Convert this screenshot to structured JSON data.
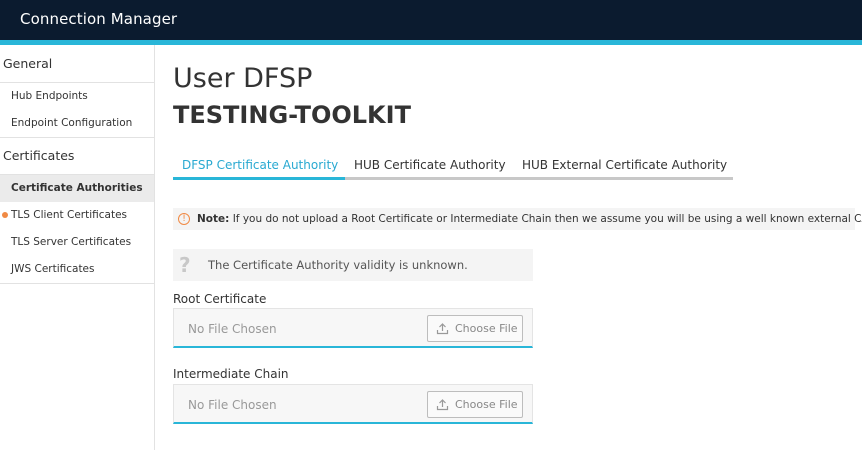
{
  "app": {
    "title": "Connection Manager"
  },
  "sidebar": {
    "sections": [
      {
        "label": "General",
        "items": [
          "Hub Endpoints",
          "Endpoint Configuration"
        ]
      },
      {
        "label": "Certificates",
        "items": [
          "Certificate Authorities",
          "TLS Client Certificates",
          "TLS Server Certificates",
          "JWS Certificates"
        ]
      }
    ],
    "active_item": "Certificate Authorities"
  },
  "page": {
    "title": "User DFSP",
    "subtitle": "TESTING-TOOLKIT"
  },
  "tabs": [
    "DFSP Certificate Authority",
    "HUB Certificate Authority",
    "HUB External Certificate Authority"
  ],
  "active_tab": "DFSP Certificate Authority",
  "note": {
    "icon": "info-icon",
    "prefix": "Note:",
    "text": "If you do not upload a Root Certificate or Intermediate Chain then we assume you will be using a well known external CA"
  },
  "validity": {
    "icon": "question-icon",
    "text": "The Certificate Authority validity is unknown."
  },
  "root_certificate": {
    "label": "Root Certificate",
    "placeholder": "No File Chosen",
    "button": "Choose File"
  },
  "intermediate_chain": {
    "label": "Intermediate Chain",
    "placeholder": "No File Chosen",
    "button": "Choose File"
  },
  "colors": {
    "topbar": "#0b1b2f",
    "accent": "#29b6d8",
    "warning": "#f08a45"
  }
}
